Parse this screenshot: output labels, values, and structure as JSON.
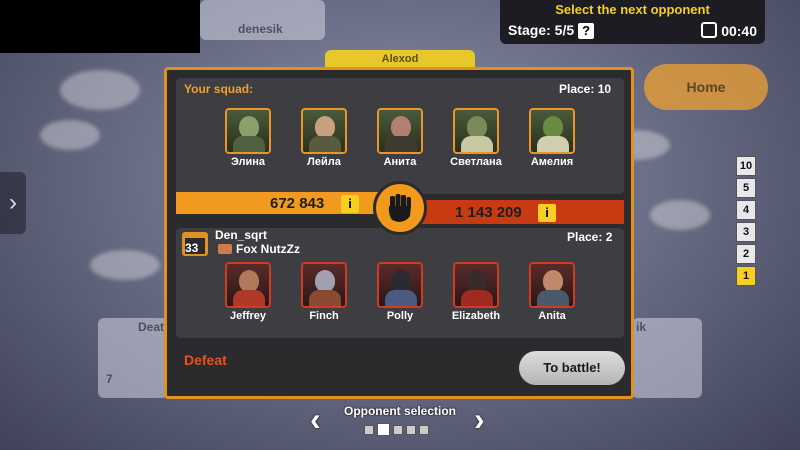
{
  "background": {
    "top_name": "denesik",
    "tab_name": "Alexod",
    "left_card_name": "Deat",
    "left_card_num": "7",
    "right_card_name": "ik"
  },
  "top_info": {
    "title": "Select the next opponent",
    "stage_label": "Stage: 5/5",
    "help": "?",
    "timer": "00:40"
  },
  "home_button": "Home",
  "ladder": [
    {
      "label": "10"
    },
    {
      "label": "5"
    },
    {
      "label": "4"
    },
    {
      "label": "3"
    },
    {
      "label": "2"
    },
    {
      "label": "1",
      "current": true
    }
  ],
  "your_squad": {
    "label": "Your squad:",
    "place": "Place: 10",
    "power": "672 843",
    "heroes": [
      "Элина",
      "Лейла",
      "Анита",
      "Светлана",
      "Амелия"
    ]
  },
  "opponent": {
    "level": "33",
    "name": "Den_sqrt",
    "clan": "Fox NutzZz",
    "place": "Place: 2",
    "power": "1 143 209",
    "heroes": [
      "Jeffrey",
      "Finch",
      "Polly",
      "Elizabeth",
      "Anita"
    ]
  },
  "info_icon": "i",
  "result": "Defeat",
  "battle_button": "To battle!",
  "opponent_selection": "Opponent selection",
  "colors": {
    "accent_orange": "#f29a1d",
    "enemy_red": "#c83a12",
    "defeat": "#e8521c",
    "title_yellow": "#f5d020"
  }
}
